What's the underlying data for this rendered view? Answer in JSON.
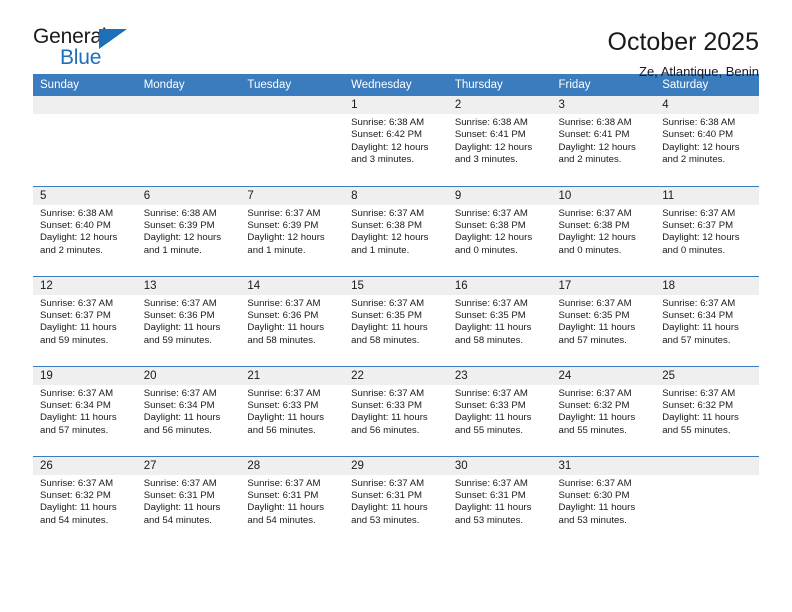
{
  "brand": {
    "name_part1": "General",
    "name_part2": "Blue",
    "accent_color": "#1c6fb8",
    "triangle_icon": "triangle-icon"
  },
  "header": {
    "title": "October 2025",
    "subtitle": "Ze, Atlantique, Benin"
  },
  "calendar": {
    "header_bg": "#3a7cbe",
    "daynum_bg": "#efefef",
    "weekday_headers": [
      "Sunday",
      "Monday",
      "Tuesday",
      "Wednesday",
      "Thursday",
      "Friday",
      "Saturday"
    ],
    "weeks": [
      [
        {
          "day": "",
          "sunrise": "",
          "sunset": "",
          "daylight": "",
          "empty": true
        },
        {
          "day": "",
          "sunrise": "",
          "sunset": "",
          "daylight": "",
          "empty": true
        },
        {
          "day": "",
          "sunrise": "",
          "sunset": "",
          "daylight": "",
          "empty": true
        },
        {
          "day": "1",
          "sunrise": "Sunrise: 6:38 AM",
          "sunset": "Sunset: 6:42 PM",
          "daylight": "Daylight: 12 hours and 3 minutes."
        },
        {
          "day": "2",
          "sunrise": "Sunrise: 6:38 AM",
          "sunset": "Sunset: 6:41 PM",
          "daylight": "Daylight: 12 hours and 3 minutes."
        },
        {
          "day": "3",
          "sunrise": "Sunrise: 6:38 AM",
          "sunset": "Sunset: 6:41 PM",
          "daylight": "Daylight: 12 hours and 2 minutes."
        },
        {
          "day": "4",
          "sunrise": "Sunrise: 6:38 AM",
          "sunset": "Sunset: 6:40 PM",
          "daylight": "Daylight: 12 hours and 2 minutes."
        }
      ],
      [
        {
          "day": "5",
          "sunrise": "Sunrise: 6:38 AM",
          "sunset": "Sunset: 6:40 PM",
          "daylight": "Daylight: 12 hours and 2 minutes."
        },
        {
          "day": "6",
          "sunrise": "Sunrise: 6:38 AM",
          "sunset": "Sunset: 6:39 PM",
          "daylight": "Daylight: 12 hours and 1 minute."
        },
        {
          "day": "7",
          "sunrise": "Sunrise: 6:37 AM",
          "sunset": "Sunset: 6:39 PM",
          "daylight": "Daylight: 12 hours and 1 minute."
        },
        {
          "day": "8",
          "sunrise": "Sunrise: 6:37 AM",
          "sunset": "Sunset: 6:38 PM",
          "daylight": "Daylight: 12 hours and 1 minute."
        },
        {
          "day": "9",
          "sunrise": "Sunrise: 6:37 AM",
          "sunset": "Sunset: 6:38 PM",
          "daylight": "Daylight: 12 hours and 0 minutes."
        },
        {
          "day": "10",
          "sunrise": "Sunrise: 6:37 AM",
          "sunset": "Sunset: 6:38 PM",
          "daylight": "Daylight: 12 hours and 0 minutes."
        },
        {
          "day": "11",
          "sunrise": "Sunrise: 6:37 AM",
          "sunset": "Sunset: 6:37 PM",
          "daylight": "Daylight: 12 hours and 0 minutes."
        }
      ],
      [
        {
          "day": "12",
          "sunrise": "Sunrise: 6:37 AM",
          "sunset": "Sunset: 6:37 PM",
          "daylight": "Daylight: 11 hours and 59 minutes."
        },
        {
          "day": "13",
          "sunrise": "Sunrise: 6:37 AM",
          "sunset": "Sunset: 6:36 PM",
          "daylight": "Daylight: 11 hours and 59 minutes."
        },
        {
          "day": "14",
          "sunrise": "Sunrise: 6:37 AM",
          "sunset": "Sunset: 6:36 PM",
          "daylight": "Daylight: 11 hours and 58 minutes."
        },
        {
          "day": "15",
          "sunrise": "Sunrise: 6:37 AM",
          "sunset": "Sunset: 6:35 PM",
          "daylight": "Daylight: 11 hours and 58 minutes."
        },
        {
          "day": "16",
          "sunrise": "Sunrise: 6:37 AM",
          "sunset": "Sunset: 6:35 PM",
          "daylight": "Daylight: 11 hours and 58 minutes."
        },
        {
          "day": "17",
          "sunrise": "Sunrise: 6:37 AM",
          "sunset": "Sunset: 6:35 PM",
          "daylight": "Daylight: 11 hours and 57 minutes."
        },
        {
          "day": "18",
          "sunrise": "Sunrise: 6:37 AM",
          "sunset": "Sunset: 6:34 PM",
          "daylight": "Daylight: 11 hours and 57 minutes."
        }
      ],
      [
        {
          "day": "19",
          "sunrise": "Sunrise: 6:37 AM",
          "sunset": "Sunset: 6:34 PM",
          "daylight": "Daylight: 11 hours and 57 minutes."
        },
        {
          "day": "20",
          "sunrise": "Sunrise: 6:37 AM",
          "sunset": "Sunset: 6:34 PM",
          "daylight": "Daylight: 11 hours and 56 minutes."
        },
        {
          "day": "21",
          "sunrise": "Sunrise: 6:37 AM",
          "sunset": "Sunset: 6:33 PM",
          "daylight": "Daylight: 11 hours and 56 minutes."
        },
        {
          "day": "22",
          "sunrise": "Sunrise: 6:37 AM",
          "sunset": "Sunset: 6:33 PM",
          "daylight": "Daylight: 11 hours and 56 minutes."
        },
        {
          "day": "23",
          "sunrise": "Sunrise: 6:37 AM",
          "sunset": "Sunset: 6:33 PM",
          "daylight": "Daylight: 11 hours and 55 minutes."
        },
        {
          "day": "24",
          "sunrise": "Sunrise: 6:37 AM",
          "sunset": "Sunset: 6:32 PM",
          "daylight": "Daylight: 11 hours and 55 minutes."
        },
        {
          "day": "25",
          "sunrise": "Sunrise: 6:37 AM",
          "sunset": "Sunset: 6:32 PM",
          "daylight": "Daylight: 11 hours and 55 minutes."
        }
      ],
      [
        {
          "day": "26",
          "sunrise": "Sunrise: 6:37 AM",
          "sunset": "Sunset: 6:32 PM",
          "daylight": "Daylight: 11 hours and 54 minutes."
        },
        {
          "day": "27",
          "sunrise": "Sunrise: 6:37 AM",
          "sunset": "Sunset: 6:31 PM",
          "daylight": "Daylight: 11 hours and 54 minutes."
        },
        {
          "day": "28",
          "sunrise": "Sunrise: 6:37 AM",
          "sunset": "Sunset: 6:31 PM",
          "daylight": "Daylight: 11 hours and 54 minutes."
        },
        {
          "day": "29",
          "sunrise": "Sunrise: 6:37 AM",
          "sunset": "Sunset: 6:31 PM",
          "daylight": "Daylight: 11 hours and 53 minutes."
        },
        {
          "day": "30",
          "sunrise": "Sunrise: 6:37 AM",
          "sunset": "Sunset: 6:31 PM",
          "daylight": "Daylight: 11 hours and 53 minutes."
        },
        {
          "day": "31",
          "sunrise": "Sunrise: 6:37 AM",
          "sunset": "Sunset: 6:30 PM",
          "daylight": "Daylight: 11 hours and 53 minutes."
        },
        {
          "day": "",
          "sunrise": "",
          "sunset": "",
          "daylight": "",
          "empty": true
        }
      ]
    ]
  }
}
